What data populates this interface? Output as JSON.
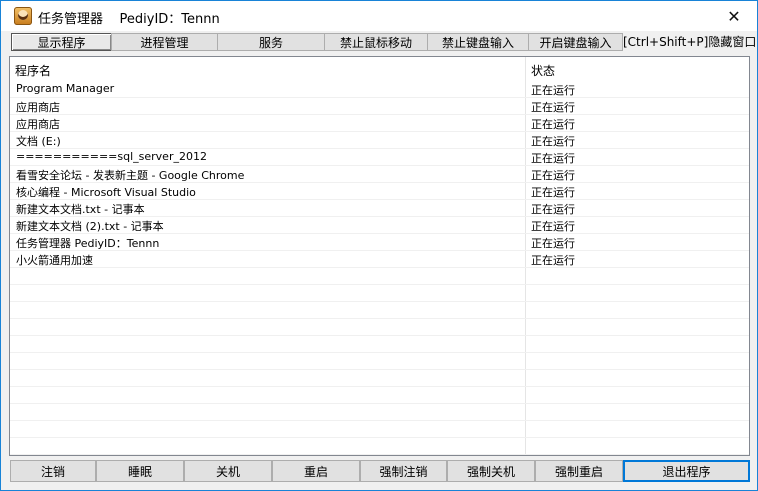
{
  "window": {
    "title": "任务管理器    PediyID：Tennn",
    "close_glyph": "✕"
  },
  "tabs": [
    {
      "label": "显示程序",
      "active": true
    },
    {
      "label": "进程管理",
      "active": false
    },
    {
      "label": "服务",
      "active": false
    },
    {
      "label": "禁止鼠标移动",
      "active": false
    },
    {
      "label": "禁止键盘输入",
      "active": false
    },
    {
      "label": "开启键盘输入",
      "active": false
    }
  ],
  "hotkey_hint": "[Ctrl+Shift+P]隐藏窗口",
  "list": {
    "columns": {
      "name": "程序名",
      "status": "状态"
    },
    "rows": [
      {
        "name": "Program Manager",
        "status": "正在运行"
      },
      {
        "name": "应用商店",
        "status": "正在运行"
      },
      {
        "name": "应用商店",
        "status": "正在运行"
      },
      {
        "name": "文档 (E:)",
        "status": "正在运行"
      },
      {
        "name": "===========sql_server_2012",
        "status": "正在运行"
      },
      {
        "name": "看雪安全论坛 - 发表新主题 - Google Chrome",
        "status": "正在运行"
      },
      {
        "name": "核心编程 - Microsoft Visual Studio",
        "status": "正在运行"
      },
      {
        "name": "新建文本文档.txt - 记事本",
        "status": "正在运行"
      },
      {
        "name": "新建文本文档 (2).txt - 记事本",
        "status": "正在运行"
      },
      {
        "name": "任务管理器    PediyID：Tennn",
        "status": "正在运行"
      },
      {
        "name": "小火箭通用加速",
        "status": "正在运行"
      }
    ]
  },
  "footer_buttons": [
    {
      "label": "注销"
    },
    {
      "label": "睡眠"
    },
    {
      "label": "关机"
    },
    {
      "label": "重启"
    },
    {
      "label": "强制注销"
    },
    {
      "label": "强制关机"
    },
    {
      "label": "强制重启"
    },
    {
      "label": "退出程序"
    }
  ]
}
